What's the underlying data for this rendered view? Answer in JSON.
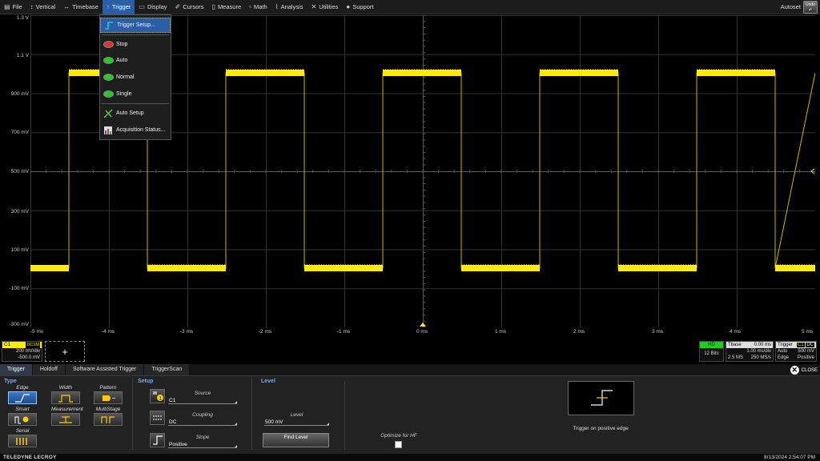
{
  "menubar": {
    "items": [
      {
        "label": "File",
        "icon": "file-icon"
      },
      {
        "label": "Vertical",
        "icon": "vertical-icon"
      },
      {
        "label": "Timebase",
        "icon": "timebase-icon"
      },
      {
        "label": "Trigger",
        "icon": "trigger-icon"
      },
      {
        "label": "Display",
        "icon": "display-icon"
      },
      {
        "label": "Cursors",
        "icon": "cursors-icon"
      },
      {
        "label": "Measure",
        "icon": "measure-icon"
      },
      {
        "label": "Math",
        "icon": "math-icon"
      },
      {
        "label": "Analysis",
        "icon": "analysis-icon"
      },
      {
        "label": "Utilities",
        "icon": "utilities-icon"
      },
      {
        "label": "Support",
        "icon": "support-icon"
      }
    ],
    "active": "Trigger",
    "autoset_label": "Autoset",
    "undo_label": "Undo"
  },
  "trigger_menu": {
    "items": [
      {
        "label": "Trigger Setup...",
        "icon": "trigger-setup-icon"
      },
      {
        "label": "Stop",
        "icon": "stop-icon"
      },
      {
        "label": "Auto",
        "icon": "auto-icon"
      },
      {
        "label": "Normal",
        "icon": "normal-icon"
      },
      {
        "label": "Single",
        "icon": "single-icon"
      },
      {
        "label": "Auto Setup",
        "icon": "auto-setup-icon"
      },
      {
        "label": "Acquisition Status...",
        "icon": "acquisition-status-icon"
      }
    ]
  },
  "grid": {
    "y_labels": [
      "1.3 V",
      "1.1 V",
      "900 mV",
      "700 mV",
      "500 mV",
      "300 mV",
      "100 mV",
      "-100 mV",
      "-300 mV"
    ],
    "x_labels": [
      "-5 ms",
      "-4 ms",
      "-3 ms",
      "-2 ms",
      "-1 ms",
      "0 ms",
      "1 ms",
      "2 ms",
      "3 ms",
      "4 ms",
      "5 ms"
    ],
    "trace_color": "#ffea00",
    "channel_marker": "C1"
  },
  "channel": {
    "name": "C1",
    "coupling": "DC1M",
    "vdiv": "200 mV/div",
    "offset": "-500.0 mV"
  },
  "hd": {
    "tag": "HD",
    "bits": "12 Bits"
  },
  "timebase": {
    "label": "Tbase",
    "delay": "0.00 ms",
    "tdiv": "1.00 ms/div",
    "samples": "2.5 MS",
    "rate": "250 MS/s"
  },
  "trigger_info": {
    "label": "Trigger",
    "source_tag": "C1",
    "coupling_tag": "DC",
    "mode": "Auto",
    "level": "500 mV",
    "type": "Edge",
    "slope": "Positive"
  },
  "dialog": {
    "tabs": [
      "Trigger",
      "Holdoff",
      "Software Assisted Trigger",
      "TriggerScan"
    ],
    "close_label": "CLOSE",
    "type_title": "Type",
    "types": [
      "Edge",
      "Width",
      "Pattern",
      "Smart",
      "Measurement",
      "MultiStage",
      "Serial"
    ],
    "setup_title": "Setup",
    "source_label": "Source",
    "source_value": "C1",
    "coupling_label": "Coupling",
    "coupling_value": "DC",
    "slope_label": "Slope",
    "slope_value": "Positive",
    "level_title": "Level",
    "level_label": "Level",
    "level_value": "500 mV",
    "find_level_label": "Find Level",
    "optimize_label": "Optimize for HF",
    "preview_caption": "Trigger on positive edge"
  },
  "statusbar": {
    "brand": "TELEDYNE LECROY",
    "datetime": "8/13/2024 2:54:07 PM"
  }
}
